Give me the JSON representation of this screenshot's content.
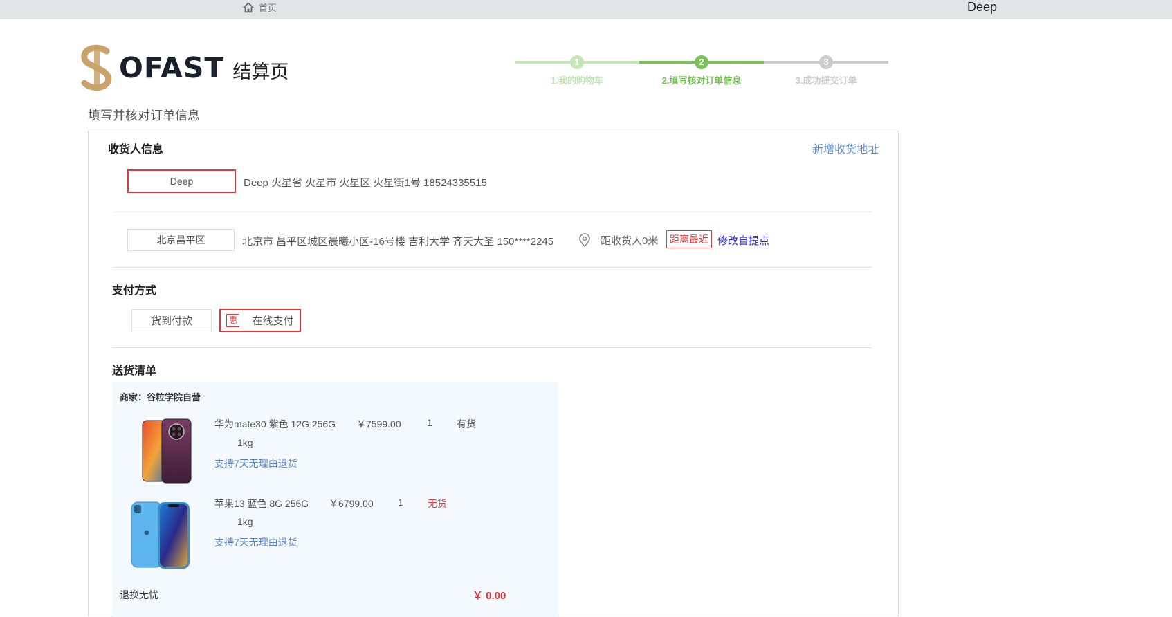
{
  "topbar": {
    "home_label": "首页",
    "user_name": "Deep"
  },
  "header": {
    "logo_text": "OFAST",
    "page_subtitle": "结算页"
  },
  "steps": [
    {
      "num": "1",
      "label": "1.我的购物车",
      "status": "done",
      "color": "#c6e6b5"
    },
    {
      "num": "2",
      "label": "2.填写核对订单信息",
      "status": "current",
      "color": "#79c15a"
    },
    {
      "num": "3",
      "label": "3.成功提交订单",
      "status": "todo",
      "color": "#cccccc"
    }
  ],
  "page_title": "填写并核对订单信息",
  "receiver": {
    "title": "收货人信息",
    "add_link": "新增收货地址",
    "selected": {
      "name": "Deep",
      "address": "Deep 火星省 火星市 火星区 火星街1号 18524335515"
    },
    "pickup": {
      "name": "北京昌平区",
      "address": "北京市 昌平区城区晨曦小区-16号楼 吉利大学 齐天大圣 150****2245",
      "distance": "距收货人0米",
      "badge": "距离最近",
      "modify_link": "修改自提点"
    }
  },
  "payment": {
    "title": "支付方式",
    "options": [
      {
        "label": "货到付款",
        "selected": false
      },
      {
        "label": "在线支付",
        "selected": true,
        "badge": "惠"
      }
    ]
  },
  "delivery": {
    "title": "送货清单",
    "merchant": "商家：谷粒学院自营",
    "items": [
      {
        "name": "华为mate30 紫色 12G 256G",
        "price": "￥7599.00",
        "qty": "1",
        "stock": "有货",
        "weight": "1kg",
        "service": "支持7天无理由退货"
      },
      {
        "name": "苹果13 蓝色 8G 256G",
        "price": "￥6799.00",
        "qty": "1",
        "stock": "无货",
        "weight": "1kg",
        "service": "支持7天无理由退货"
      }
    ],
    "footer_label": "退换无忧",
    "footer_price": "￥ 0.00"
  },
  "colors": {
    "brand_red": "#e4393c",
    "link_blue": "#5b8dd6",
    "step_green": "#79c15a",
    "logo_gold": "#c9a36a"
  }
}
